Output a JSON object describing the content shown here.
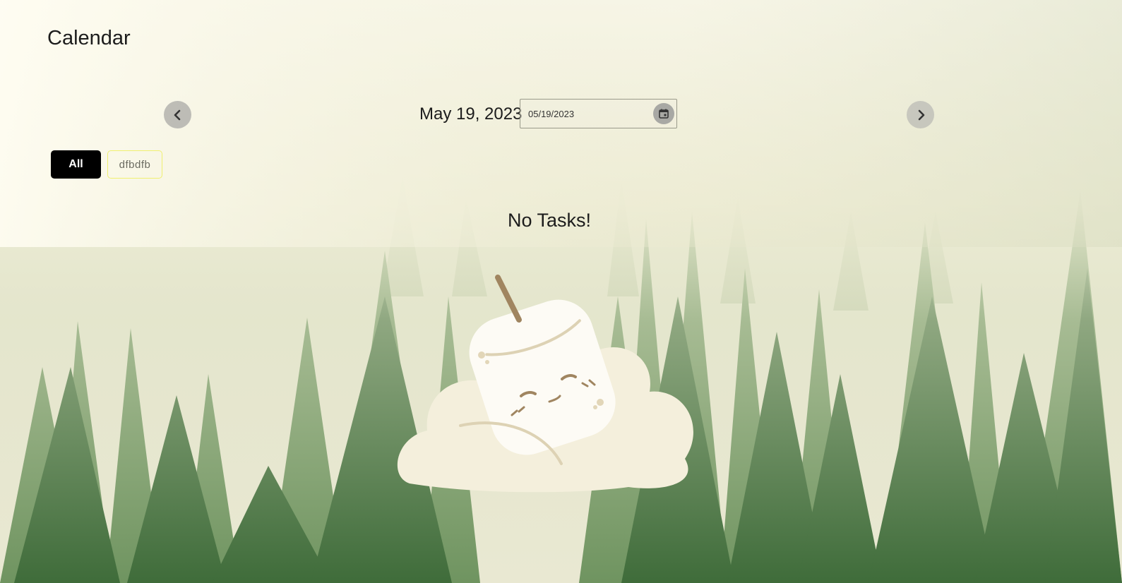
{
  "header": {
    "title": "Calendar"
  },
  "date_nav": {
    "current_date_label": "May 19, 2023",
    "date_input_value": "05/19/2023",
    "prev_icon": "chevron-left-icon",
    "next_icon": "chevron-right-icon",
    "picker_icon": "calendar-icon"
  },
  "filters": {
    "items": [
      {
        "label": "All",
        "active": true
      },
      {
        "label": "dfbdfb",
        "active": false
      }
    ]
  },
  "empty_state": {
    "message": "No Tasks!",
    "illustration": "sleeping-marshmallow-illustration"
  },
  "colors": {
    "active_filter_bg": "#000000",
    "tag_border": "#f0f070",
    "nav_button_bg": "#969696"
  }
}
